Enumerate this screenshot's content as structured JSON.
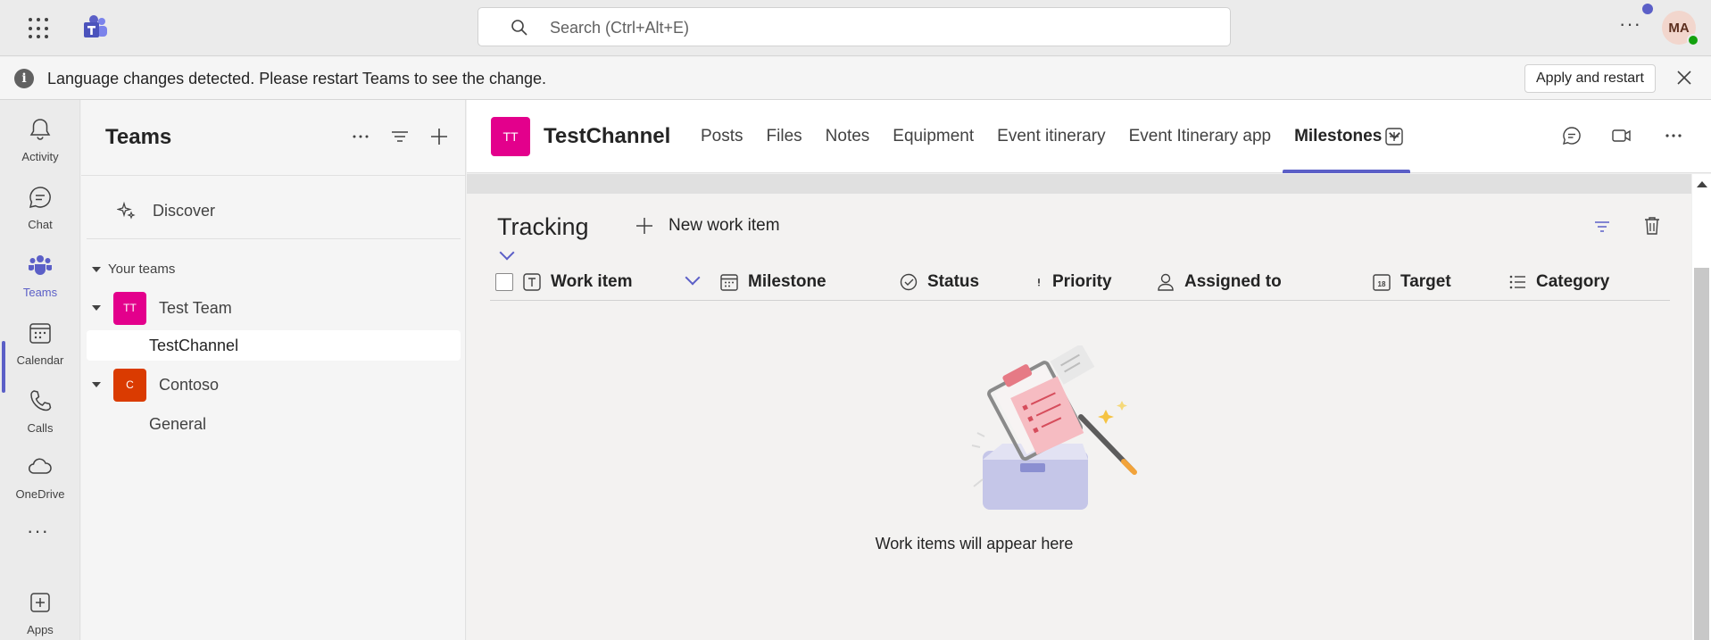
{
  "topbar": {
    "search_placeholder": "Search (Ctrl+Alt+E)",
    "avatar_initials": "MA"
  },
  "banner": {
    "message": "Language changes detected. Please restart Teams to see the change.",
    "button_label": "Apply and restart"
  },
  "rail": {
    "items": [
      {
        "label": "Activity",
        "icon": "bell-icon"
      },
      {
        "label": "Chat",
        "icon": "chat-icon"
      },
      {
        "label": "Teams",
        "icon": "teams-icon"
      },
      {
        "label": "Calendar",
        "icon": "calendar-icon"
      },
      {
        "label": "Calls",
        "icon": "phone-icon"
      },
      {
        "label": "OneDrive",
        "icon": "cloud-icon"
      },
      {
        "label": "Apps",
        "icon": "apps-add-icon"
      }
    ],
    "active": "Teams",
    "more_label": "..."
  },
  "pane": {
    "title": "Teams",
    "discover_label": "Discover",
    "your_teams_label": "Your teams",
    "teams": [
      {
        "initials": "TT",
        "name": "Test Team",
        "color": "#e3008c",
        "channels": [
          "TestChannel"
        ]
      },
      {
        "initials": "C",
        "name": "Contoso",
        "color": "#da3b01",
        "channels": [
          "General"
        ]
      }
    ],
    "selected_channel": "TestChannel"
  },
  "channel": {
    "initials": "TT",
    "name": "TestChannel",
    "tabs": [
      "Posts",
      "Files",
      "Notes",
      "Equipment",
      "Event itinerary",
      "Event Itinerary app",
      "Milestones"
    ],
    "active_tab": "Milestones"
  },
  "content": {
    "title": "Tracking",
    "new_item_label": "New work item",
    "columns": [
      "Work item",
      "Milestone",
      "Status",
      "Priority",
      "Assigned to",
      "Target",
      "Category"
    ],
    "empty_message": "Work items will appear here"
  },
  "colors": {
    "accent": "#5b5fc7",
    "team_pink": "#e3008c",
    "team_orange": "#da3b01",
    "presence": "#13a10e"
  }
}
